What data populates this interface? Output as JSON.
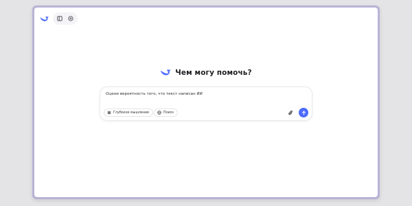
{
  "greeting": {
    "title": "Чем могу помочь?"
  },
  "input": {
    "value": "Оцени вероятность того, что текст написан ИИ"
  },
  "options": {
    "deep_thinking_label": "Глубокое мышление",
    "search_label": "Поиск"
  },
  "colors": {
    "accent": "#4d6bfe",
    "frame": "#b9b3d6",
    "background": "#e4e4e7"
  },
  "icons": {
    "brand": "whale-logo-icon",
    "sidebar": "sidebar-toggle-icon",
    "new_chat": "new-chat-icon",
    "deep_thinking": "atom-icon",
    "search": "globe-icon",
    "attach": "paperclip-icon",
    "send": "arrow-up-icon"
  }
}
